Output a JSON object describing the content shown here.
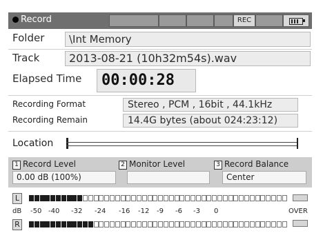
{
  "title_bar": {
    "title": "Record",
    "rec_badge": "REC",
    "battery_icon": "battery-icon"
  },
  "folder": {
    "label": "Folder",
    "value": "\\Int Memory"
  },
  "track": {
    "label": "Track",
    "value": "2013-08-21 (10h32m54s).wav"
  },
  "elapsed": {
    "label": "Elapsed Time",
    "value": "00:00:28"
  },
  "recording_format": {
    "label": "Recording Format",
    "value": "Stereo , PCM , 16bit , 44.1kHz"
  },
  "recording_remain": {
    "label": "Recording Remain",
    "value": "14.4G bytes (about 024:23:12)"
  },
  "location": {
    "label": "Location"
  },
  "panel": {
    "record_level": {
      "num": "1",
      "label": "Record Level",
      "value": "0.00 dB (100%)"
    },
    "monitor_level": {
      "num": "2",
      "label": "Monitor Level",
      "value": ""
    },
    "record_balance": {
      "num": "3",
      "label": "Record Balance",
      "value": "Center"
    }
  },
  "meter": {
    "left_label": "L",
    "right_label": "R",
    "scale_unit": "dB",
    "scale": [
      "-50",
      "-40",
      "-32",
      "-24",
      "-16",
      "-12",
      "-9",
      "-6",
      "-3",
      "0"
    ],
    "over_label": "OVER",
    "left_level_fraction": 0.21,
    "right_level_fraction": 0.25
  }
}
